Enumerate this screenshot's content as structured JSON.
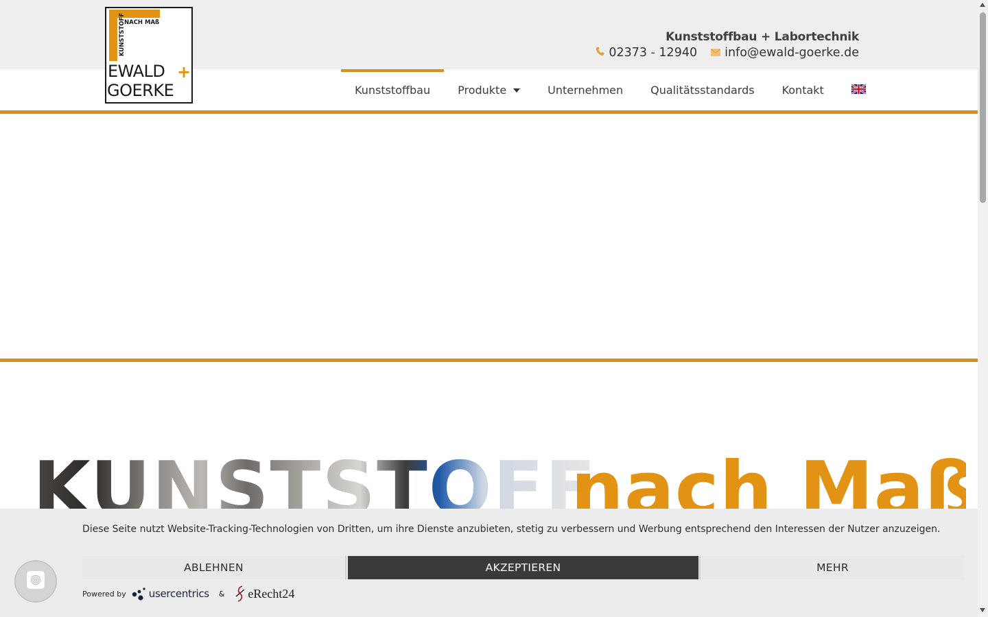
{
  "header": {
    "tagline": "Kunststoffbau + Labortechnik",
    "phone": "02373 - 12940",
    "email": "info@ewald-goerke.de",
    "phone_icon": "phone-icon",
    "mail_icon": "mail-icon"
  },
  "logo": {
    "line1": "KUNSTSTOFF",
    "line2": "NACH MAß",
    "name1": "EWALD",
    "plus": "+",
    "name2": "GOERKE"
  },
  "nav": {
    "items": [
      {
        "label": "Kunststoffbau",
        "active": true
      },
      {
        "label": "Produkte",
        "has_dropdown": true
      },
      {
        "label": "Unternehmen"
      },
      {
        "label": "Qualitätsstandards"
      },
      {
        "label": "Kontakt"
      }
    ],
    "language_icon": "uk-flag-icon"
  },
  "hero": {
    "word1": "KUNSTSTOFF",
    "word2": "nach Maß"
  },
  "cookie_banner": {
    "text": "Diese Seite nutzt Website-Tracking-Technologien von Dritten, um ihre Dienste anzubieten, stetig zu verbessern und Werbung entsprechend den Interessen der Nutzer anzuzeigen.",
    "decline_label": "ABLEHNEN",
    "accept_label": "AKZEPTIEREN",
    "more_label": "MEHR",
    "powered_by": "Powered by",
    "provider1": "usercentrics",
    "ampersand": "&",
    "provider2": "eRecht24"
  },
  "colors": {
    "accent": "#d98e1a",
    "hero_orange": "#e39313",
    "topband": "#eeeeee",
    "accept_bg": "#3a3a3a"
  }
}
